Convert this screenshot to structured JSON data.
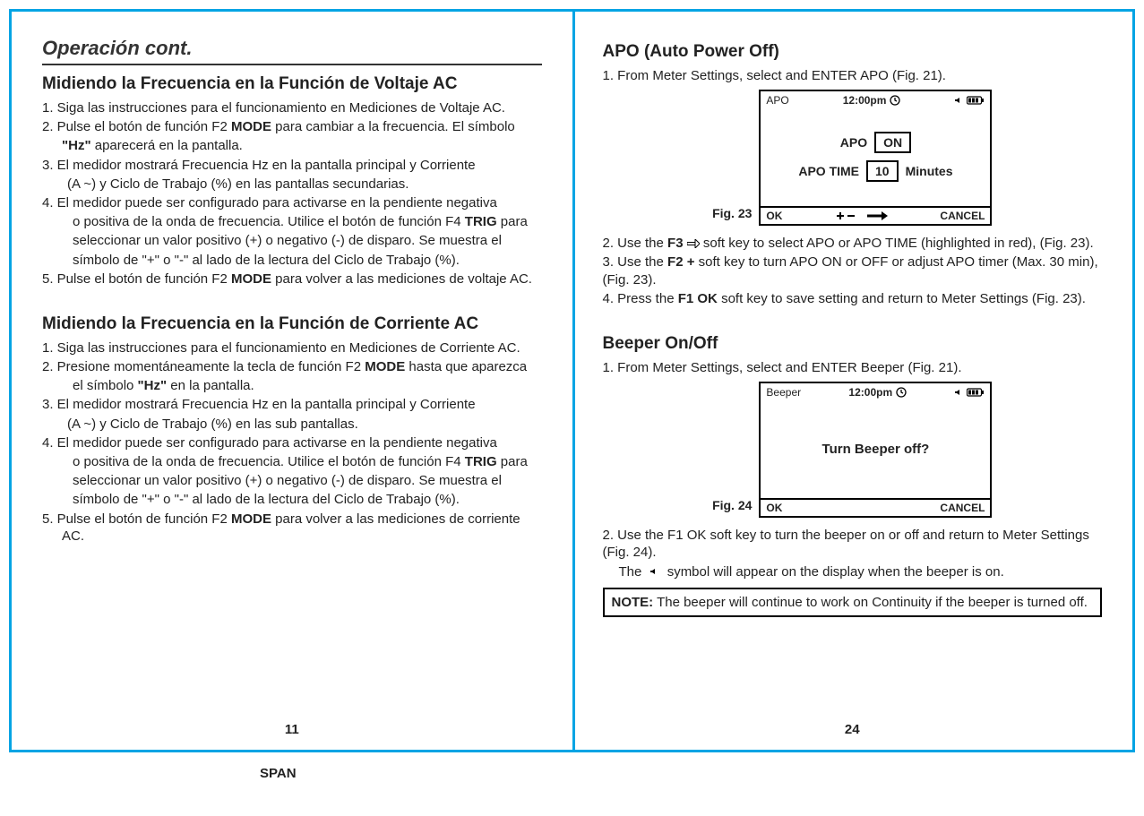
{
  "footer": {
    "span_label": "SPAN"
  },
  "left": {
    "page_number": "11",
    "section_title": "Operación cont.",
    "h1": "Midiendo la Frecuencia en la Función de Voltaje AC",
    "p1": "1. Siga las instrucciones para el funcionamiento en Mediciones de Voltaje AC.",
    "p2a": "2. Pulse el botón de función F2 ",
    "p2b": "MODE",
    "p2c": " para cambiar a la frecuencia. El símbolo",
    "p2d": "\"Hz\"",
    "p2e": " aparecerá en la pantalla.",
    "p3a": "3. El medidor mostrará Frecuencia Hz en la pantalla principal y Corriente",
    "p3b": "(A ~) y Ciclo de Trabajo (%) en las pantallas secundarias.",
    "p4a": "4. El medidor puede ser configurado para activarse en la pendiente negativa",
    "p4b": "o positiva de la onda de frecuencia. Utilice el botón de función F4 ",
    "p4c": "TRIG",
    "p4d": " para",
    "p4e": "seleccionar un valor positivo (+) o negativo (-) de disparo. Se muestra el",
    "p4f": "símbolo de \"+\" o \"-\" al lado de la lectura del Ciclo de Trabajo (%).",
    "p5a": "5. Pulse el botón de función F2 ",
    "p5b": "MODE",
    "p5c": " para volver a las mediciones de voltaje AC.",
    "h2": "Midiendo la Frecuencia en la Función de Corriente AC",
    "q1": "1. Siga las instrucciones para el funcionamiento en Mediciones de Corriente AC.",
    "q2a": "2. Presione momentáneamente la tecla de función F2 ",
    "q2b": "MODE",
    "q2c": " hasta que aparezca",
    "q2d": "el símbolo ",
    "q2e": "\"Hz\"",
    "q2f": " en la pantalla.",
    "q3a": "3. El medidor mostrará Frecuencia Hz en la pantalla principal y Corriente",
    "q3b": "(A ~) y Ciclo de Trabajo (%) en las sub pantallas.",
    "q4a": "4. El medidor puede ser configurado para activarse en la pendiente negativa",
    "q4b": "o positiva de la onda de frecuencia. Utilice el botón de función F4 ",
    "q4c": "TRIG",
    "q4d": " para",
    "q4e": "seleccionar un valor positivo (+) o negativo (-) de disparo. Se muestra el",
    "q4f": "símbolo de \"+\" o \"-\" al lado de la lectura del Ciclo de Trabajo (%).",
    "q5a": "5. Pulse el botón de función F2 ",
    "q5b": "MODE",
    "q5c": " para volver a las mediciones de corriente AC."
  },
  "right": {
    "page_number": "24",
    "h1": "APO (Auto Power Off)",
    "p1": "1. From Meter Settings, select and ENTER APO (Fig. 21).",
    "fig23": {
      "caption": "Fig. 23",
      "top_label": "APO",
      "time": "12:00pm",
      "row1_label": "APO",
      "row1_value": "ON",
      "row2_label": "APO TIME",
      "row2_value": "10",
      "row2_unit": "Minutes",
      "ok": "OK",
      "cancel": "CANCEL"
    },
    "p2a": "2. Use the ",
    "p2b": "F3",
    "p2c": " soft key to select APO or APO TIME (highlighted in red), (Fig. 23).",
    "p3a": "3. Use the ",
    "p3b": "F2 +",
    "p3c": " soft key to turn APO ON or OFF or adjust APO timer (Max. 30 min), (Fig. 23).",
    "p4a": "4. Press the ",
    "p4b": "F1 OK",
    "p4c": " soft key to save setting and return to Meter Settings (Fig. 23).",
    "h2": "Beeper On/Off",
    "b1": "1. From Meter Settings, select and ENTER Beeper (Fig. 21).",
    "fig24": {
      "caption": "Fig. 24",
      "top_label": "Beeper",
      "time": "12:00pm",
      "prompt": "Turn Beeper off?",
      "ok": "OK",
      "cancel": "CANCEL"
    },
    "b2a": "2. Use the F1 OK soft key to turn the beeper on or off and return to Meter Settings (Fig. 24).",
    "b2b": "The ",
    "b2c": " symbol will appear on the display when the beeper is on.",
    "note_label": "NOTE:",
    "note_text": " The beeper will continue to work on Continuity if the beeper is turned off."
  }
}
